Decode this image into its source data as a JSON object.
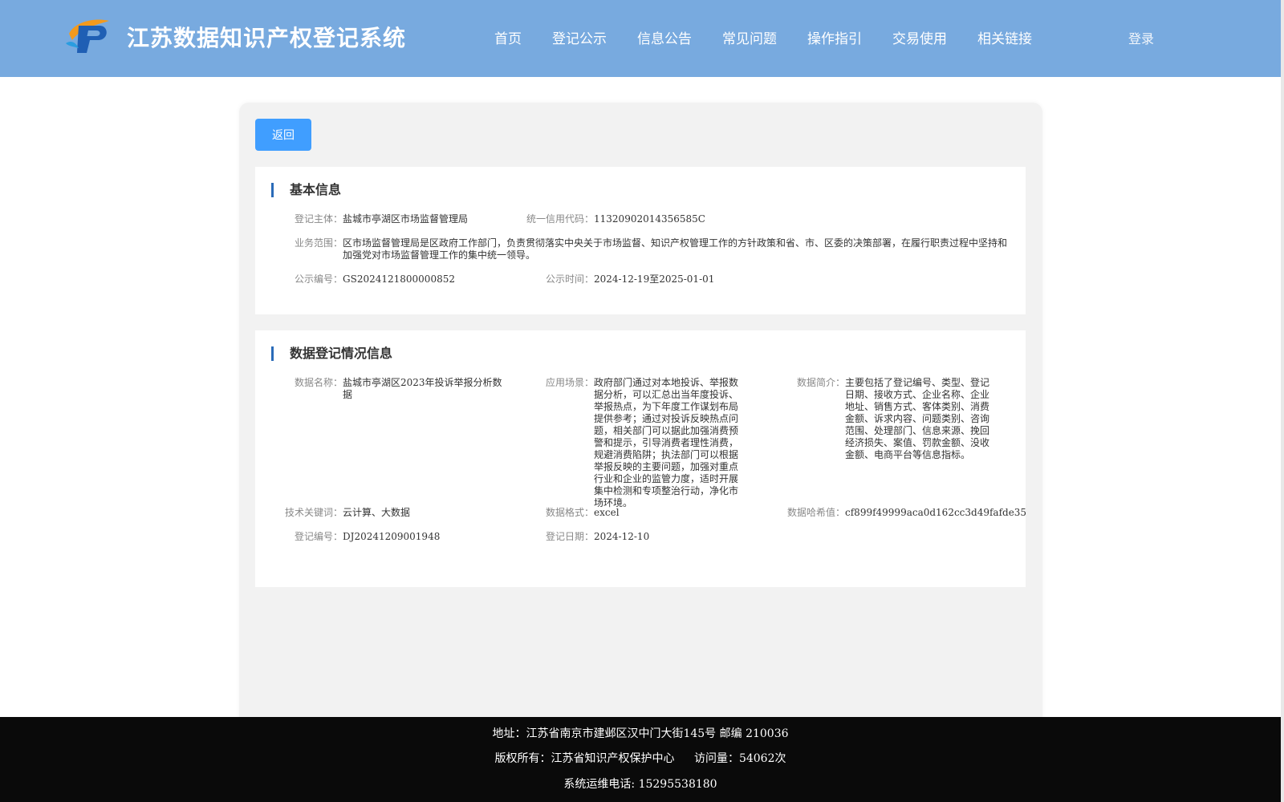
{
  "header": {
    "logo_icon": "logo-icon",
    "title": "江苏数据知识产权登记系统",
    "nav": [
      "首页",
      "登记公示",
      "信息公告",
      "常见问题",
      "操作指引",
      "交易使用",
      "相关链接"
    ],
    "login": "登录"
  },
  "back_button": "返回",
  "basic_info": {
    "title": "基本信息",
    "subject_label": "登记主体：",
    "subject_value": "盐城市亭湖区市场监督管理局",
    "credit_label": "统一信用代码：",
    "credit_value": "11320902014356585C",
    "scope_label": "业务范围：",
    "scope_value": "区市场监督管理局是区政府工作部门，负责贯彻落实中央关于市场监督、知识产权管理工作的方针政策和省、市、区委的决策部署，在履行职责过程中坚持和加强党对市场监督管理工作的集中统一领导。",
    "pub_no_label": "公示编号：",
    "pub_no_value": "GS2024121800000852",
    "pub_time_label": "公示时间：",
    "pub_time_value": "2024-12-19至2025-01-01"
  },
  "registration_info": {
    "title": "数据登记情况信息",
    "name_label": "数据名称：",
    "name_value": "盐城市亭湖区2023年投诉举报分析数据",
    "scene_label": "应用场景：",
    "scene_value": "政府部门通过对本地投诉、举报数据分析，可以汇总出当年度投诉、举报热点，为下年度工作谋划布局提供参考；通过对投诉反映热点问题，相关部门可以据此加强消费预警和提示，引导消费者理性消费，规避消费陷阱；执法部门可以根据举报反映的主要问题，加强对重点行业和企业的监管力度，适时开展集中检测和专项整治行动，净化市场环境。",
    "intro_label": "数据简介：",
    "intro_value": "主要包括了登记编号、类型、登记日期、接收方式、企业名称、企业地址、销售方式、客体类别、消费金额、诉求内容、问题类别、咨询范围、处理部门、信息来源、挽回经济损失、案值、罚款金额、没收金额、电商平台等信息指标。",
    "keywords_label": "技术关键词：",
    "keywords_value": "云计算、大数据",
    "format_label": "数据格式：",
    "format_value": "excel",
    "hash_label": "数据哈希值：",
    "hash_value": "cf899f49999aca0d162cc3d49fafde35",
    "reg_no_label": "登记编号：",
    "reg_no_value": "DJ20241209001948",
    "reg_date_label": "登记日期：",
    "reg_date_value": "2024-12-10"
  },
  "footer": {
    "address": "地址：江苏省南京市建邺区汉中门大街145号 邮编 210036",
    "copyright": "版权所有：江苏省知识产权保护中心",
    "visits": "访问量：54062次",
    "phone": "系统运维电话: 15295538180"
  },
  "colors": {
    "header_bg": "#78aadf",
    "button_blue": "#409eff",
    "footer_bg": "#0a0a0a",
    "accent_bar": "#2a6bb8"
  }
}
